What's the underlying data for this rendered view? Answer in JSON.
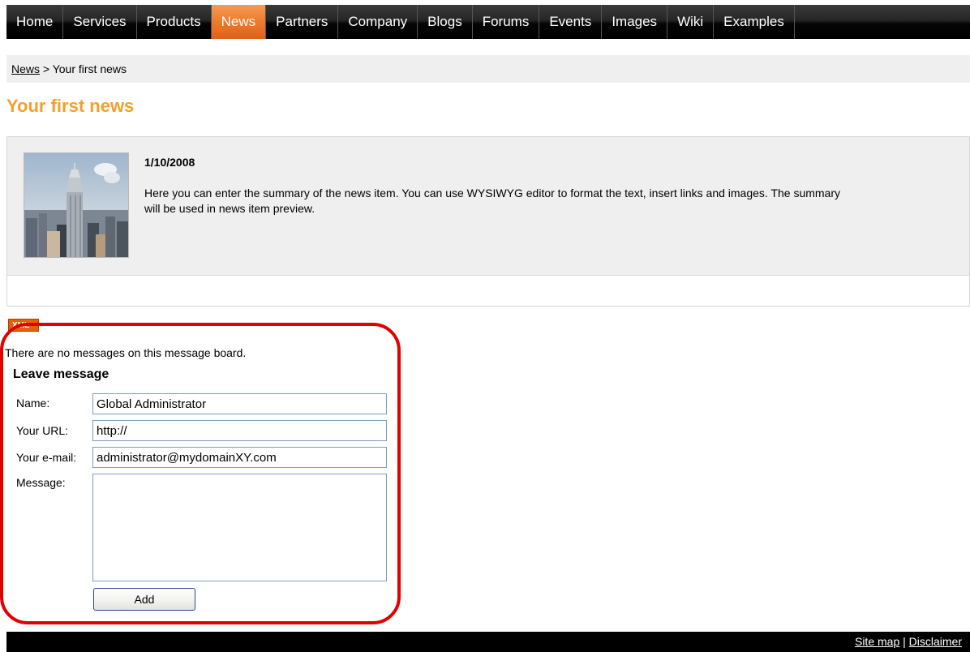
{
  "nav": {
    "items": [
      {
        "label": "Home"
      },
      {
        "label": "Services"
      },
      {
        "label": "Products"
      },
      {
        "label": "News"
      },
      {
        "label": "Partners"
      },
      {
        "label": "Company"
      },
      {
        "label": "Blogs"
      },
      {
        "label": "Forums"
      },
      {
        "label": "Events"
      },
      {
        "label": "Images"
      },
      {
        "label": "Wiki"
      },
      {
        "label": "Examples"
      }
    ],
    "active": "News",
    "active_color": "#ee7a2a"
  },
  "breadcrumb": {
    "parent": "News",
    "separator": " > ",
    "current": "Your first news"
  },
  "page": {
    "title": "Your first news",
    "title_color": "#f5a02a"
  },
  "news": {
    "date": "1/10/2008",
    "summary": "Here you can enter the summary of the news item. You can use WYSIWYG editor to format the text, insert links and images. The summary will be used in news item preview.",
    "image_icon": "skyscraper-photo"
  },
  "rss": {
    "label": "XML"
  },
  "board": {
    "empty_text": "There are no messages on this message board.",
    "form_title": "Leave message",
    "name_label": "Name:",
    "name_value": "Global Administrator",
    "url_label": "Your URL:",
    "url_value": "http://",
    "email_label": "Your e-mail:",
    "email_value": "administrator@mydomainXY.com",
    "message_label": "Message:",
    "message_value": "",
    "add_label": "Add"
  },
  "footer": {
    "sitemap": "Site map",
    "separator": " | ",
    "disclaimer": "Disclaimer"
  }
}
